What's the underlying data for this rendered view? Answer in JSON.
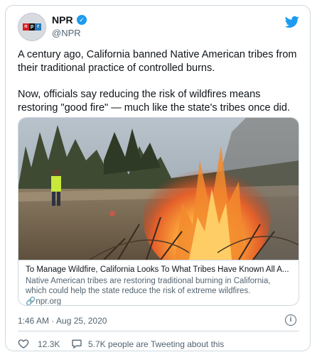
{
  "account": {
    "name": "NPR",
    "handle": "@NPR",
    "logo_letters": [
      "n",
      "p",
      "r"
    ],
    "logo_colors": [
      "#d62021",
      "#121212",
      "#237bbd"
    ]
  },
  "tweet": {
    "paragraph1": "A century ago, California banned Native American tribes from their traditional practice of controlled burns.",
    "paragraph2": "Now, officials say reducing the risk of wildfires means restoring \"good fire\" —  much like the state's tribes once did."
  },
  "link_card": {
    "title": "To Manage Wildfire, California Looks To What Tribes Have Known All A...",
    "description": "Native American tribes are restoring traditional burning in California, which could help the state reduce the risk of extreme wildfires.",
    "domain": "npr.org",
    "domain_icon": "link-icon"
  },
  "meta": {
    "timestamp": "1:46 AM · Aug 25, 2020",
    "info_icon": "info-icon"
  },
  "actions": {
    "likes": "12.3K",
    "tweeting": "5.7K people are Tweeting about this",
    "like_icon": "heart-icon",
    "reply_icon": "speech-bubble-icon"
  },
  "colors": {
    "twitter_blue": "#1d9bf0",
    "text_primary": "#0f1419",
    "text_secondary": "#536471",
    "border": "#cfd9de"
  }
}
